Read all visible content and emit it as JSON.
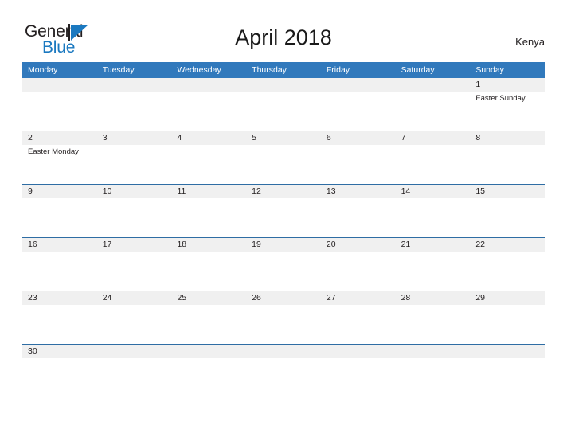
{
  "logo": {
    "word_one": "General",
    "word_two": "Blue",
    "triangle_icon": "triangle-icon",
    "accent_color": "#1b79c0"
  },
  "header": {
    "title": "April 2018",
    "country": "Kenya"
  },
  "calendar": {
    "header_color": "#3179bc",
    "date_band_color": "#f0f0f0",
    "grid_line_color": "#2e6da4",
    "day_names": [
      "Monday",
      "Tuesday",
      "Wednesday",
      "Thursday",
      "Friday",
      "Saturday",
      "Sunday"
    ],
    "weeks": [
      {
        "dates": [
          "",
          "",
          "",
          "",
          "",
          "",
          "1"
        ],
        "events": [
          [],
          [],
          [],
          [],
          [],
          [],
          [
            "Easter Sunday"
          ]
        ]
      },
      {
        "dates": [
          "2",
          "3",
          "4",
          "5",
          "6",
          "7",
          "8"
        ],
        "events": [
          [
            "Easter Monday"
          ],
          [],
          [],
          [],
          [],
          [],
          []
        ]
      },
      {
        "dates": [
          "9",
          "10",
          "11",
          "12",
          "13",
          "14",
          "15"
        ],
        "events": [
          [],
          [],
          [],
          [],
          [],
          [],
          []
        ]
      },
      {
        "dates": [
          "16",
          "17",
          "18",
          "19",
          "20",
          "21",
          "22"
        ],
        "events": [
          [],
          [],
          [],
          [],
          [],
          [],
          []
        ]
      },
      {
        "dates": [
          "23",
          "24",
          "25",
          "26",
          "27",
          "28",
          "29"
        ],
        "events": [
          [],
          [],
          [],
          [],
          [],
          [],
          []
        ]
      },
      {
        "dates": [
          "30",
          "",
          "",
          "",
          "",
          "",
          ""
        ],
        "events": [
          [],
          [],
          [],
          [],
          [],
          [],
          []
        ]
      }
    ]
  }
}
